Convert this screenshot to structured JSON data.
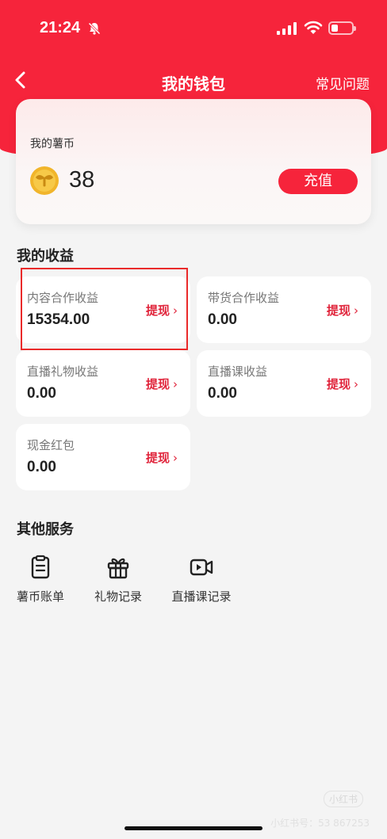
{
  "status_bar": {
    "time": "21:24"
  },
  "nav": {
    "title": "我的钱包",
    "faq_label": "常见问题"
  },
  "wallet": {
    "label": "我的薯币",
    "amount": "38",
    "recharge_label": "充值"
  },
  "earnings": {
    "title": "我的收益",
    "withdraw_label": "提现",
    "items": [
      {
        "label": "内容合作收益",
        "value": "15354.00"
      },
      {
        "label": "带货合作收益",
        "value": "0.00"
      },
      {
        "label": "直播礼物收益",
        "value": "0.00"
      },
      {
        "label": "直播课收益",
        "value": "0.00"
      },
      {
        "label": "现金红包",
        "value": "0.00"
      }
    ]
  },
  "services": {
    "title": "其他服务",
    "items": [
      {
        "label": "薯币账单",
        "icon": "bill-icon"
      },
      {
        "label": "礼物记录",
        "icon": "gift-icon"
      },
      {
        "label": "直播课记录",
        "icon": "video-icon"
      }
    ]
  },
  "watermark": {
    "logo": "小红书",
    "text": "小红书号：53 867253"
  },
  "colors": {
    "brand": "#f6243b",
    "accent_text": "#e0233a",
    "highlight": "#ea2a2a"
  }
}
